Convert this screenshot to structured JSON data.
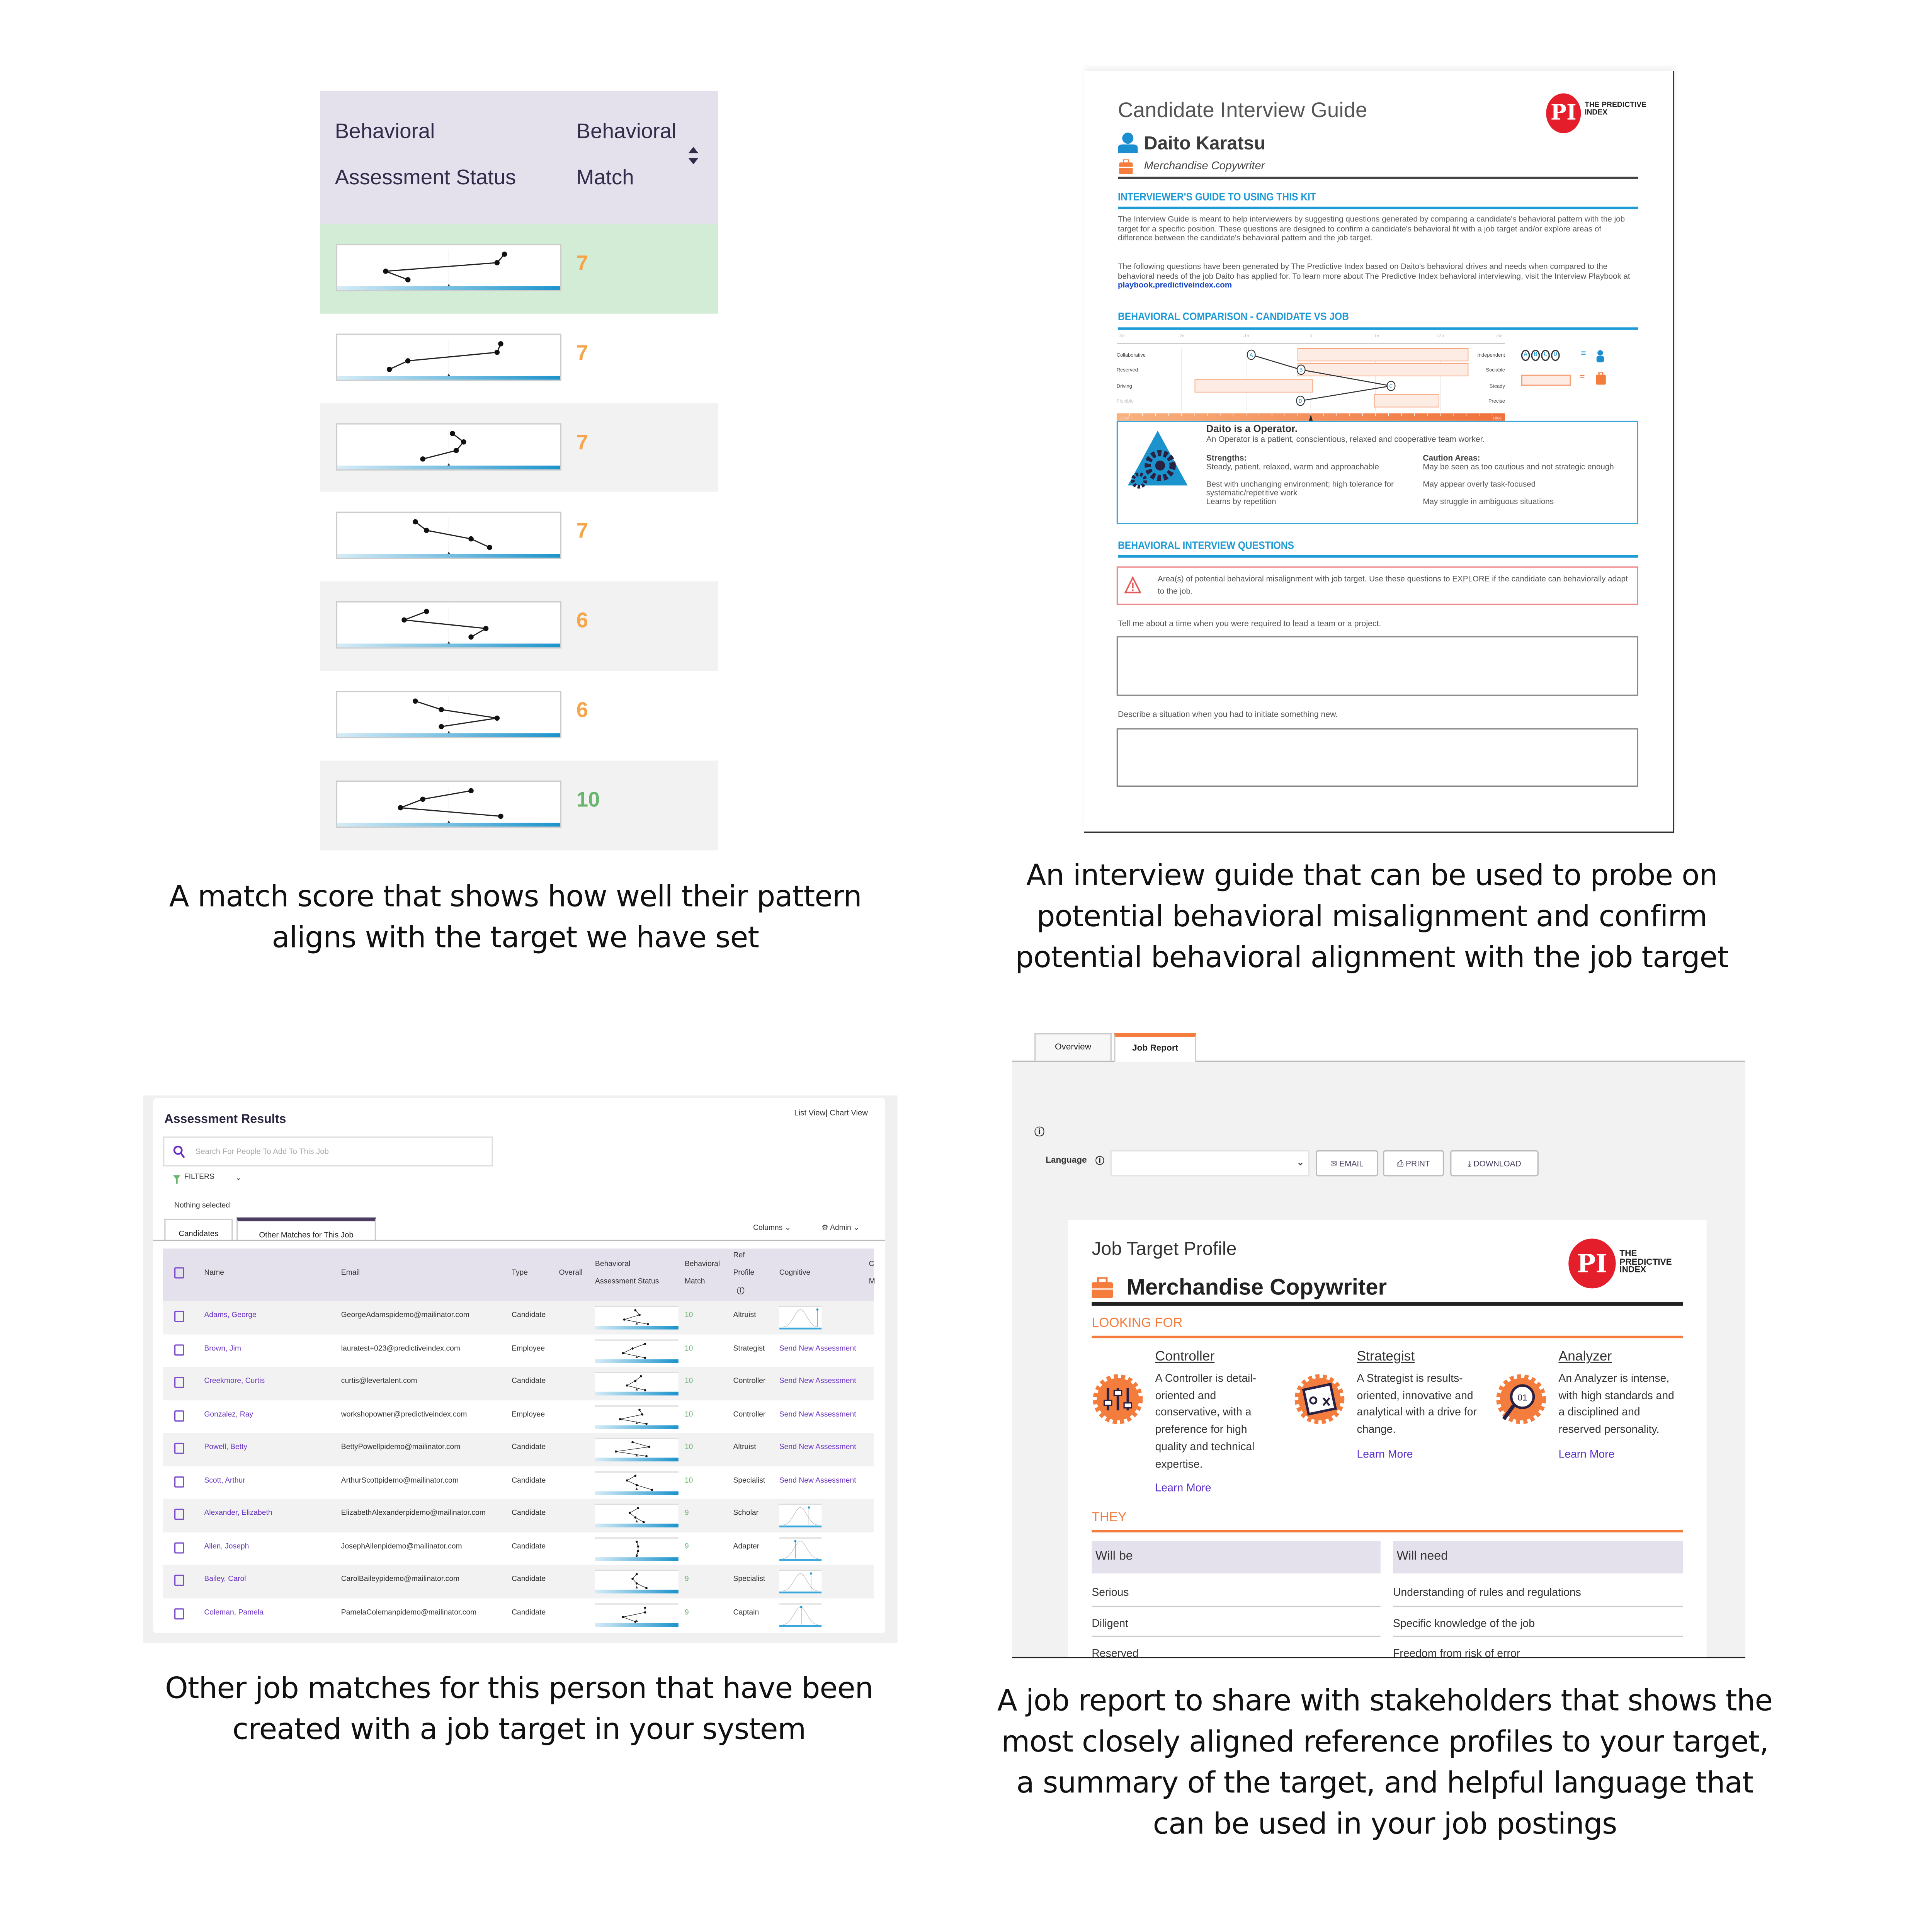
{
  "colors": {
    "lavender": "#e4e1ec",
    "match_highlight": "#d2ecd6",
    "score_orange": "#f5a54a",
    "score_green": "#6ab56e",
    "guide_blue": "#1e9bd7",
    "accent_orange": "#f47c3c",
    "logo_red": "#e41e2b",
    "link_purple": "#6a35c4"
  },
  "match_panel": {
    "header": {
      "col1_line1": "Behavioral",
      "col1_line2": "Assessment Status",
      "col2_line1": "Behavioral",
      "col2_line2": "Match",
      "sort_icon": "sort-arrows-icon"
    },
    "rows": [
      {
        "pattern": [
          1.5,
          1.3,
          -1.7,
          -1.1
        ],
        "score": "7",
        "highlight": true
      },
      {
        "pattern": [
          1.4,
          1.3,
          -1.1,
          -1.6
        ],
        "score": "7"
      },
      {
        "pattern": [
          0.1,
          0.4,
          0.2,
          -0.7
        ],
        "score": "7"
      },
      {
        "pattern": [
          -0.9,
          -0.6,
          0.6,
          1.1
        ],
        "score": "7"
      },
      {
        "pattern": [
          -0.6,
          -1.2,
          1.0,
          0.6
        ],
        "score": "6"
      },
      {
        "pattern": [
          -0.9,
          -0.2,
          1.3,
          -0.2
        ],
        "score": "6"
      },
      {
        "pattern": [
          0.6,
          -0.7,
          -1.3,
          1.4
        ],
        "score": "10"
      }
    ],
    "caption": "A match score that shows how well their pattern aligns with the target we have set"
  },
  "interview_guide": {
    "title": "Candidate Interview Guide",
    "candidate_name": "Daito Karatsu",
    "job_title": "Merchandise Copywriter",
    "logo": {
      "mark": "PI",
      "text": "THE PREDICTIVE INDEX"
    },
    "section1": "INTERVIEWER'S GUIDE TO USING THIS KIT",
    "para1": "The Interview Guide is meant to help interviewers by suggesting questions generated by comparing a candidate's behavioral pattern with the job target for a specific position. These questions are designed to confirm a candidate's behavioral fit with a job target and/or explore areas of difference between the candidate's behavioral pattern and the job target.",
    "para2": "The following questions have been generated by The Predictive Index based on Daito's behavioral drives and needs when compared to the behavioral needs of the job Daito has applied for. To learn more about The Predictive Index behavioral interviewing, visit the Interview Playbook at ",
    "para2_link": "playbook.predictiveindex.com",
    "section2": "BEHAVIORAL COMPARISON - CANDIDATE VS JOB",
    "chart_data": {
      "type": "range-dot",
      "x_ticks": [
        "-3σ",
        "-2σ",
        "-1σ",
        "0",
        "+1σ",
        "+2σ",
        "+3σ"
      ],
      "xlim": [
        -3,
        3
      ],
      "factors": [
        {
          "id": "A",
          "left": "Collaborative",
          "right": "Independent",
          "candidate": -0.92,
          "job_range": [
            -0.2,
            2.43
          ]
        },
        {
          "id": "B",
          "left": "Reserved",
          "right": "Sociable",
          "candidate": -0.15,
          "job_range": [
            -0.2,
            2.43
          ]
        },
        {
          "id": "C",
          "left": "Driving",
          "right": "Steady",
          "candidate": 1.24,
          "job_range": [
            -1.79,
            0.03
          ]
        },
        {
          "id": "D",
          "left": "Flexible",
          "right": "Precise",
          "candidate": -0.16,
          "job_range": [
            0.98,
            1.98
          ]
        }
      ],
      "scale_low": "LOW",
      "scale_high": "HIGH",
      "legend": {
        "candidate_label": "ABCD",
        "candidate_icon": "person-icon",
        "job_icon": "briefcase-icon",
        "equals": "="
      }
    },
    "profile": {
      "title": "Daito is a Operator.",
      "description": "An Operator is a patient, conscientious, relaxed and cooperative team worker.",
      "strengths_label": "Strengths:",
      "strengths": [
        "Steady, patient, relaxed, warm and approachable",
        "Best with unchanging environment; high tolerance for systematic/repetitive work",
        "Learns by repetition"
      ],
      "caution_label": "Caution Areas:",
      "cautions": [
        "May be seen as too cautious and not strategic enough",
        "May appear overly task-focused",
        "May struggle in ambiguous situations"
      ]
    },
    "section3": "BEHAVIORAL INTERVIEW QUESTIONS",
    "warning": "Area(s) of potential behavioral misalignment with job target. Use these questions to EXPLORE if the candidate can behaviorally adapt to the job.",
    "questions": [
      "Tell me about a time when you were required to lead a team or a project.",
      "Describe a situation when you had to initiate something new."
    ],
    "caption": "An interview guide that can be used to probe on potential behavioral misalignment and confirm potential behavioral alignment with the job target"
  },
  "assessment_results": {
    "title": "Assessment Results",
    "view_toggle": "List View| Chart View",
    "search_placeholder": "Search For People To Add To This Job",
    "filters": "FILTERS",
    "selection_status": "Nothing selected",
    "tabs": [
      {
        "label": "Candidates"
      },
      {
        "label": "Other Matches for This Job",
        "active": true
      }
    ],
    "columns_label": "Columns",
    "admin_label": "Admin",
    "headers": {
      "name": "Name",
      "email": "Email",
      "type": "Type",
      "overall": "Overall",
      "bas_1": "Behavioral",
      "bas_2": "Assessment Status",
      "bm_1": "Behavioral",
      "bm_2": "Match",
      "ref_1": "Ref",
      "ref_2": "Profile",
      "cognitive": "Cognitive",
      "next_1": "C",
      "next_2": "M"
    },
    "rows": [
      {
        "name": "Adams, George",
        "email": "GeorgeAdamspidemo@mailinator.com",
        "type": "Candidate",
        "pattern": [
          -0.1,
          0.2,
          -0.9,
          0.8
        ],
        "match": "10",
        "ref_profile": "Altruist",
        "cognitive_marker": 0.9
      },
      {
        "name": "Brown, Jim",
        "email": "lauratest+023@predictiveindex.com",
        "type": "Employee",
        "pattern": [
          0.6,
          -0.3,
          -1.0,
          0.6
        ],
        "match": "10",
        "ref_profile": "Strategist",
        "cognitive_link": "Send New Assessment"
      },
      {
        "name": "Creekmore, Curtis",
        "email": "curtis@levertalent.com",
        "type": "Candidate",
        "pattern": [
          0.3,
          -0.1,
          -0.7,
          0.6
        ],
        "match": "10",
        "ref_profile": "Controller",
        "cognitive_link": "Send New Assessment"
      },
      {
        "name": "Gonzalez, Ray",
        "email": "workshopowner@predictiveindex.com",
        "type": "Employee",
        "pattern": [
          0.2,
          0.4,
          -1.2,
          0.7
        ],
        "match": "10",
        "ref_profile": "Controller",
        "cognitive_link": "Send New Assessment"
      },
      {
        "name": "Powell, Betty",
        "email": "BettyPowellpidemo@mailinator.com",
        "type": "Candidate",
        "pattern": [
          -0.3,
          0.9,
          -1.5,
          0.7
        ],
        "match": "10",
        "ref_profile": "Altruist",
        "cognitive_link": "Send New Assessment"
      },
      {
        "name": "Scott, Arthur",
        "email": "ArthurScottpidemo@mailinator.com",
        "type": "Candidate",
        "pattern": [
          -0.1,
          -0.7,
          0.0,
          1.1
        ],
        "match": "10",
        "ref_profile": "Specialist",
        "cognitive_link": "Send New Assessment"
      },
      {
        "name": "Alexander, Elizabeth",
        "email": "ElizabethAlexanderpidemo@mailinator.com",
        "type": "Candidate",
        "pattern": [
          0.1,
          -0.5,
          -0.1,
          0.5
        ],
        "match": "9",
        "ref_profile": "Scholar",
        "cognitive_marker": 0.7
      },
      {
        "name": "Allen, Joseph",
        "email": "JosephAllenpidemo@mailinator.com",
        "type": "Candidate",
        "pattern": [
          0.0,
          0.1,
          0.1,
          0.0
        ],
        "match": "9",
        "ref_profile": "Adapter",
        "cognitive_marker": 0.38
      },
      {
        "name": "Bailey, Carol",
        "email": "CarolBaileypidemo@mailinator.com",
        "type": "Candidate",
        "pattern": [
          0.0,
          -0.3,
          0.0,
          0.7
        ],
        "match": "9",
        "ref_profile": "Specialist",
        "cognitive_marker": 0.75
      },
      {
        "name": "Coleman, Pamela",
        "email": "PamelaColemanpidemo@mailinator.com",
        "type": "Candidate",
        "pattern": [
          0.6,
          0.6,
          -1.0,
          -0.1
        ],
        "match": "9",
        "ref_profile": "Captain",
        "cognitive_marker": 0.52
      }
    ],
    "caption": "Other job matches for this person that have been created with a job target in your system"
  },
  "job_report": {
    "tabs": [
      {
        "label": "Overview"
      },
      {
        "label": "Job Report",
        "active": true
      }
    ],
    "language_label": "Language",
    "language_value": "",
    "buttons": {
      "email": "EMAIL",
      "print": "PRINT",
      "download": "DOWNLOAD"
    },
    "profile_title": "Job Target Profile",
    "job_title": "Merchandise Copywriter",
    "logo": {
      "mark": "PI",
      "text": "THE PREDICTIVE INDEX"
    },
    "looking_for": "LOOKING FOR",
    "profiles": [
      {
        "name": "Controller",
        "icon": "sliders-gear-icon",
        "text": "A Controller is detail-oriented and conservative, with a preference for high quality and technical expertise.",
        "link": "Learn More"
      },
      {
        "name": "Strategist",
        "icon": "strategy-map-gear-icon",
        "text": "A Strategist is results-oriented, innovative and analytical with a drive for change.",
        "link": "Learn More"
      },
      {
        "name": "Analyzer",
        "icon": "magnifier-gear-icon",
        "text": "An Analyzer is intense, with high standards and a disciplined and reserved personality.",
        "link": "Learn More"
      }
    ],
    "they": "THEY",
    "will_be_header": "Will be",
    "will_need_header": "Will need",
    "will_be": [
      "Serious",
      "Diligent",
      "Reserved"
    ],
    "will_need": [
      "Understanding of rules and regulations",
      "Specific knowledge of the job",
      "Freedom from risk of error"
    ],
    "caption": "A job report to share with stakeholders that shows the most closely aligned reference profiles to your target, a summary of the target, and helpful language that can be used in your job postings"
  }
}
